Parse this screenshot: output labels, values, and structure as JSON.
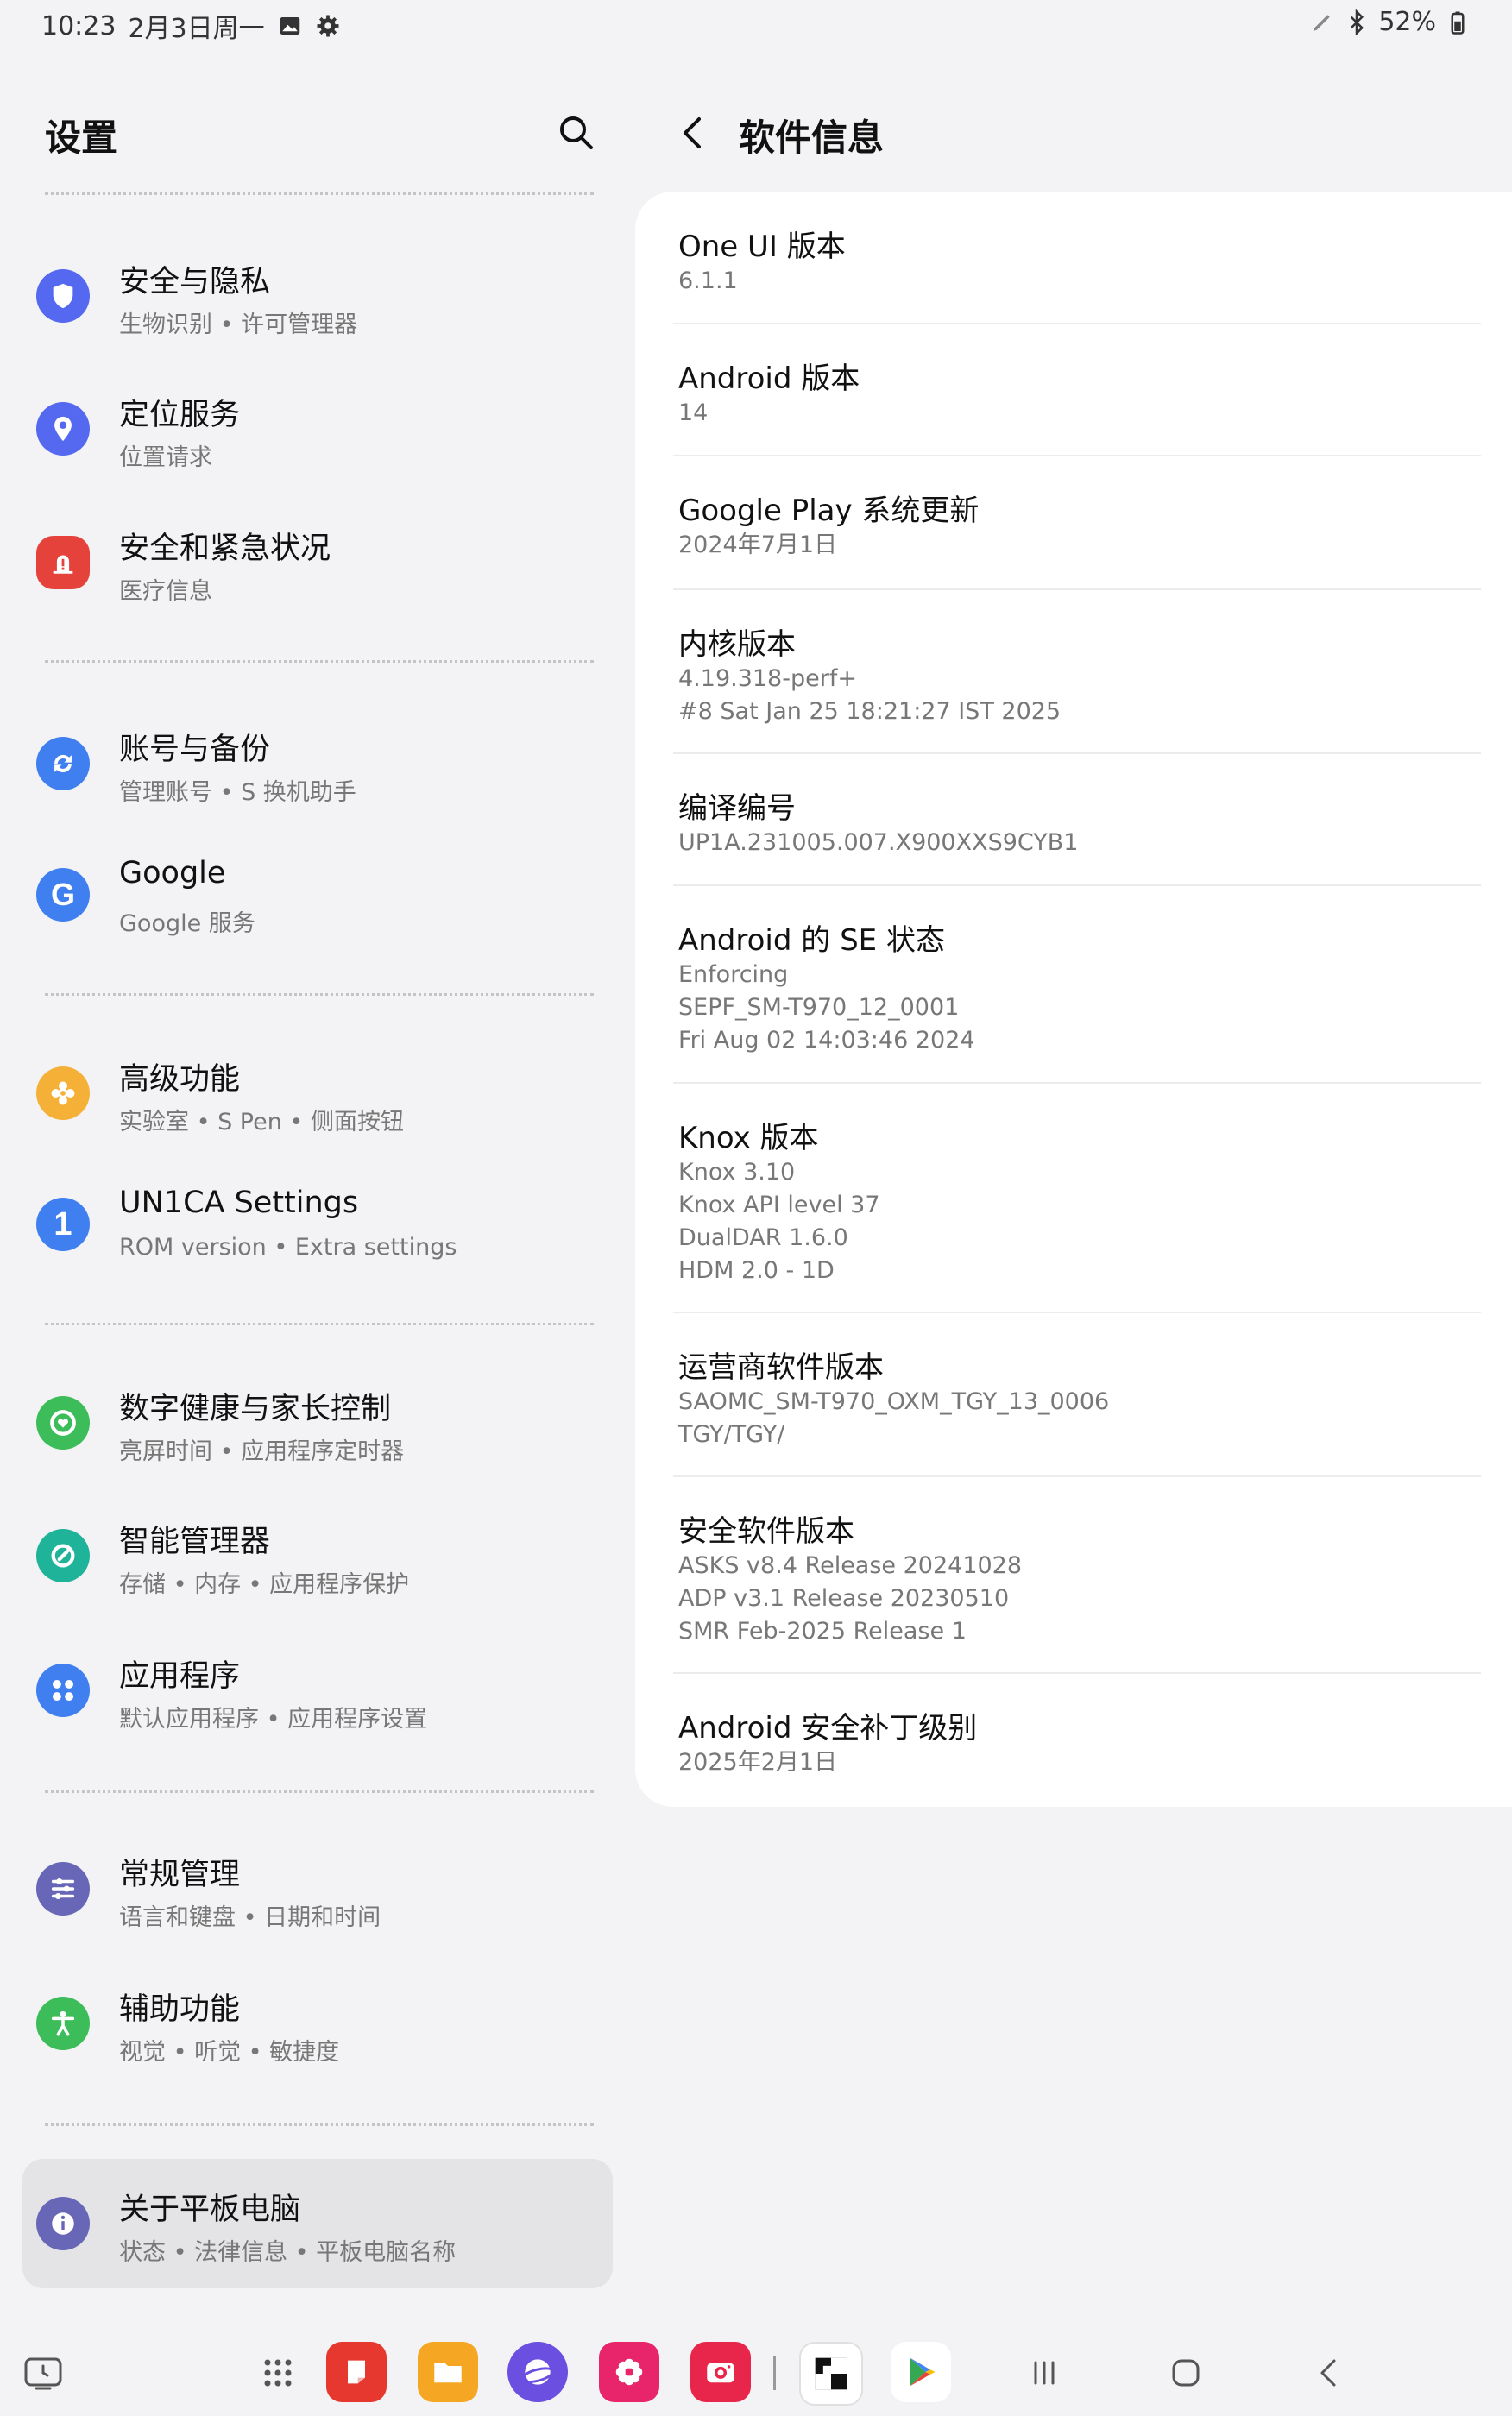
{
  "status_bar": {
    "time": "10:23",
    "date": "2月3日周一",
    "battery": "52%"
  },
  "left": {
    "title": "设置",
    "items": [
      {
        "title": "安全与隐私",
        "subtitle": "生物识别 • 许可管理器",
        "icon": "shield-icon",
        "color": "#5468f0"
      },
      {
        "title": "定位服务",
        "subtitle": "位置请求",
        "icon": "location-pin-icon",
        "color": "#5468f0"
      },
      {
        "title": "安全和紧急状况",
        "subtitle": "医疗信息",
        "icon": "emergency-icon",
        "color": "#e5423c"
      },
      {
        "title": "账号与备份",
        "subtitle": "管理账号 • S 换机助手",
        "icon": "sync-icon",
        "color": "#3f7ff0"
      },
      {
        "title": "Google",
        "subtitle": "Google 服务",
        "icon": "google-icon",
        "color": "#3f7ff0"
      },
      {
        "title": "高级功能",
        "subtitle": "实验室 • S Pen • 侧面按钮",
        "icon": "advanced-features-icon",
        "color": "#f5b038"
      },
      {
        "title": "UN1CA Settings",
        "subtitle": "ROM version • Extra settings",
        "icon": "un1ca-icon",
        "color": "#3f7ff0"
      },
      {
        "title": "数字健康与家长控制",
        "subtitle": "亮屏时间 • 应用程序定时器",
        "icon": "digital-wellbeing-icon",
        "color": "#3cbd5a"
      },
      {
        "title": "智能管理器",
        "subtitle": "存储 • 内存 • 应用程序保护",
        "icon": "device-care-icon",
        "color": "#1fb39a"
      },
      {
        "title": "应用程序",
        "subtitle": "默认应用程序 • 应用程序设置",
        "icon": "apps-grid-icon",
        "color": "#3f7ff0"
      },
      {
        "title": "常规管理",
        "subtitle": "语言和键盘 • 日期和时间",
        "icon": "sliders-icon",
        "color": "#6866b7"
      },
      {
        "title": "辅助功能",
        "subtitle": "视觉 • 听觉 • 敏捷度",
        "icon": "accessibility-icon",
        "color": "#3cbd5a"
      },
      {
        "title": "关于平板电脑",
        "subtitle": "状态 • 法律信息 • 平板电脑名称",
        "icon": "info-icon",
        "color": "#6866b7"
      }
    ]
  },
  "right": {
    "title": "软件信息",
    "info": [
      {
        "title": "One UI 版本",
        "values": [
          "6.1.1"
        ]
      },
      {
        "title": "Android 版本",
        "values": [
          "14"
        ]
      },
      {
        "title": "Google Play 系统更新",
        "values": [
          "2024年7月1日"
        ]
      },
      {
        "title": "内核版本",
        "values": [
          "4.19.318-perf+",
          "#8 Sat Jan 25 18:21:27 IST 2025"
        ]
      },
      {
        "title": "编译编号",
        "values": [
          "UP1A.231005.007.X900XXS9CYB1"
        ]
      },
      {
        "title": "Android 的 SE 状态",
        "values": [
          "Enforcing",
          "SEPF_SM-T970_12_0001",
          "Fri Aug 02 14:03:46 2024"
        ]
      },
      {
        "title": "Knox 版本",
        "values": [
          "Knox 3.10",
          "Knox API level 37",
          "DualDAR 1.6.0",
          "HDM 2.0 - 1D"
        ]
      },
      {
        "title": "运营商软件版本",
        "values": [
          "SAOMC_SM-T970_OXM_TGY_13_0006",
          "TGY/TGY/"
        ]
      },
      {
        "title": "安全软件版本",
        "values": [
          "ASKS v8.4 Release 20241028",
          "ADP v3.1 Release 20230510",
          "SMR Feb-2025 Release 1"
        ]
      },
      {
        "title": "Android 安全补丁级别",
        "values": [
          "2025年2月1日"
        ]
      }
    ]
  },
  "nav": {
    "apps": [
      {
        "icon": "notes-app-icon",
        "color": "#e6382e"
      },
      {
        "icon": "my-files-icon",
        "color": "#f5a623"
      },
      {
        "icon": "internet-browser-icon",
        "color": "#6a4fe0"
      },
      {
        "icon": "gallery-icon",
        "color": "#e8256b"
      },
      {
        "icon": "camera-app-icon",
        "color": "#e8254a"
      },
      {
        "icon": "chess-app-icon",
        "color": "#ffffff"
      },
      {
        "icon": "play-store-icon",
        "color": "#ffffff"
      }
    ]
  }
}
